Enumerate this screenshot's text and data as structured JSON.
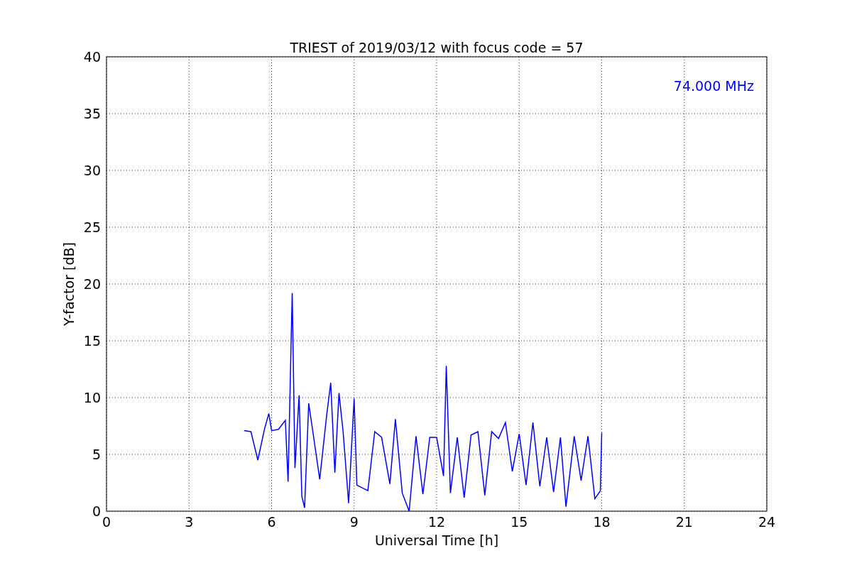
{
  "figure": {
    "chart_data": {
      "type": "line",
      "title": "TRIEST of 2019/03/12 with focus code = 57",
      "xlabel": "Universal Time [h]",
      "ylabel": "Y-factor [dB]",
      "xlim": [
        0,
        24
      ],
      "ylim": [
        0,
        40
      ],
      "xticks": [
        0,
        3,
        6,
        9,
        12,
        15,
        18,
        21,
        24
      ],
      "yticks": [
        0,
        5,
        10,
        15,
        20,
        25,
        30,
        35,
        40
      ],
      "grid": true,
      "annotations": [
        {
          "text": "74.000 MHz"
        }
      ],
      "x": [
        5.0,
        5.25,
        5.5,
        5.75,
        5.9,
        6.0,
        6.25,
        6.5,
        6.6,
        6.7,
        6.75,
        6.85,
        7.0,
        7.1,
        7.2,
        7.35,
        7.5,
        7.75,
        8.0,
        8.15,
        8.3,
        8.45,
        8.6,
        8.8,
        9.0,
        9.1,
        9.5,
        9.75,
        10.0,
        10.3,
        10.5,
        10.75,
        11.0,
        11.25,
        11.5,
        11.75,
        12.0,
        12.25,
        12.35,
        12.5,
        12.75,
        13.0,
        13.25,
        13.5,
        13.75,
        14.0,
        14.25,
        14.5,
        14.75,
        15.0,
        15.25,
        15.5,
        15.75,
        16.0,
        16.25,
        16.5,
        16.7,
        17.0,
        17.25,
        17.5,
        17.75,
        17.95,
        18.0
      ],
      "series": [
        {
          "color": "#0000ff",
          "values": [
            7.1,
            7.0,
            4.5,
            7.3,
            8.6,
            7.1,
            7.2,
            8.0,
            2.6,
            13.8,
            19.2,
            3.8,
            10.2,
            1.3,
            0.3,
            9.5,
            7.0,
            2.8,
            8.4,
            11.3,
            3.4,
            10.4,
            7.0,
            0.7,
            9.9,
            2.3,
            1.8,
            7.0,
            6.5,
            2.4,
            8.1,
            1.6,
            0.0,
            6.6,
            1.5,
            6.5,
            6.5,
            3.1,
            12.8,
            1.6,
            6.5,
            1.2,
            6.7,
            7.0,
            1.4,
            7.0,
            6.4,
            7.8,
            3.5,
            6.8,
            2.3,
            7.8,
            2.2,
            6.5,
            1.7,
            6.5,
            0.4,
            6.6,
            2.7,
            6.6,
            1.1,
            1.8,
            6.9
          ]
        }
      ]
    }
  }
}
